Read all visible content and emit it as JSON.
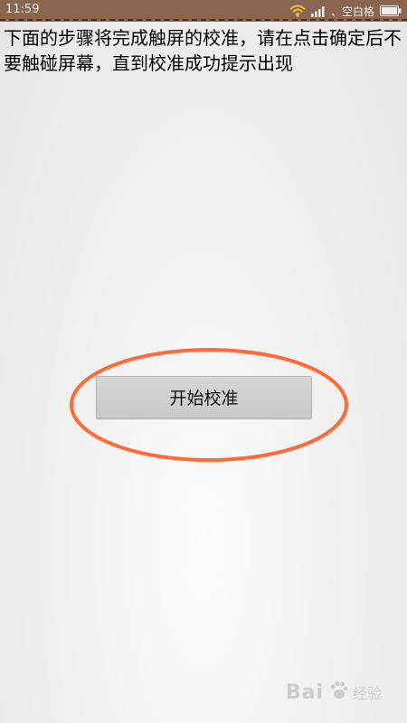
{
  "status_bar": {
    "time": "11:59",
    "carrier": "、空白格",
    "icons": [
      "wifi-icon",
      "signal-icon",
      "battery-icon"
    ]
  },
  "instruction_text": "下面的步骤将完成触屏的校准，请在点击确定后不要触碰屏幕，直到校准成功提示出现",
  "start_button_label": "开始校准",
  "colors": {
    "status_bar": "#8a6650",
    "highlight_ellipse": "#ff6a3a",
    "button": "#cfcfcf"
  },
  "watermark": {
    "text": "Bai",
    "sub": "经验"
  }
}
